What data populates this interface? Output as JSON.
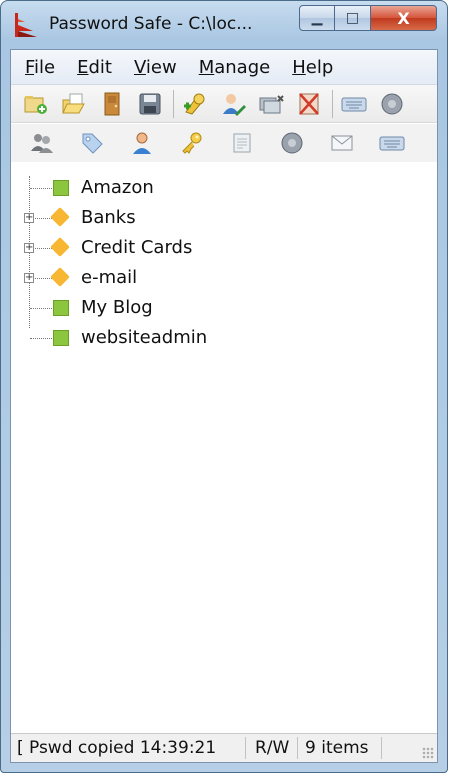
{
  "window": {
    "title": "Password Safe - C:\\loc...",
    "minimize_glyph": "▁",
    "maximize_glyph": "□",
    "close_glyph": "X"
  },
  "menu": {
    "file": {
      "ul": "F",
      "rest": "ile"
    },
    "edit": {
      "ul": "E",
      "rest": "dit"
    },
    "view": {
      "ul": "V",
      "rest": "iew"
    },
    "manage": {
      "ul": "M",
      "rest": "anage"
    },
    "help": {
      "ul": "H",
      "rest": "elp"
    }
  },
  "toolbar_primary": [
    "new-database-icon",
    "open-database-icon",
    "close-database-icon",
    "save-icon",
    "add-entry-icon",
    "edit-entry-icon",
    "delete-entry-icon",
    "clear-clipboard-icon",
    "autotype-icon",
    "browse-url-icon"
  ],
  "toolbar_secondary": [
    "copy-username-icon",
    "tag-icon",
    "user-icon",
    "key-icon",
    "notes-icon",
    "url-icon",
    "email-icon",
    "keyboard-icon"
  ],
  "tree": {
    "items": [
      {
        "label": "Amazon",
        "kind": "entry"
      },
      {
        "label": "Banks",
        "kind": "group"
      },
      {
        "label": "Credit Cards",
        "kind": "group"
      },
      {
        "label": "e-mail",
        "kind": "group"
      },
      {
        "label": "My Blog",
        "kind": "entry"
      },
      {
        "label": "websiteadmin",
        "kind": "entry"
      }
    ],
    "expander_glyph": "+"
  },
  "status": {
    "lead": "[",
    "message": "Pswd copied 14:39:21",
    "mode": "R/W",
    "count": "9 items"
  },
  "colors": {
    "entry": "#8cc63f",
    "group": "#f7b733",
    "close_button": "#c03a1f"
  }
}
